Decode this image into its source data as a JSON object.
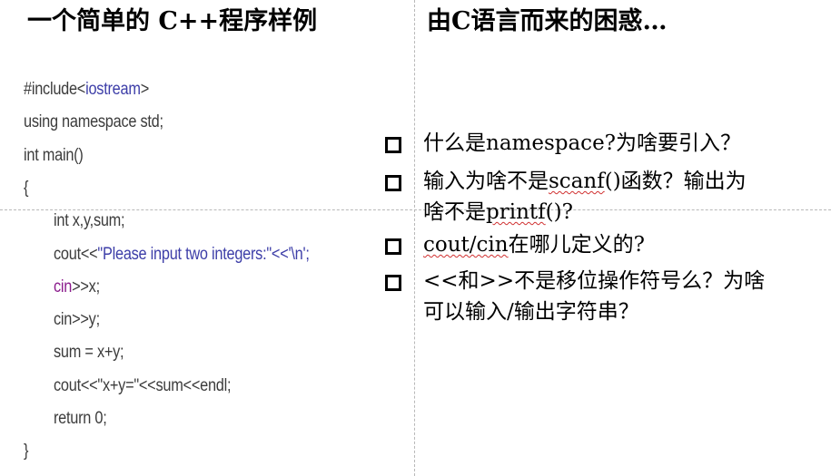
{
  "left_title": "一个简单的 C++程序样例",
  "right_title": "由C语言而来的困惑…",
  "code_lines": [
    {
      "indent": false,
      "segments": [
        {
          "text": "#include<",
          "color": "black"
        },
        {
          "text": "iostream",
          "color": "blue"
        },
        {
          "text": ">",
          "color": "black"
        }
      ]
    },
    {
      "indent": false,
      "segments": [
        {
          "text": "using namespace std;",
          "color": "black"
        }
      ]
    },
    {
      "indent": false,
      "segments": [
        {
          "text": "int main()",
          "color": "black"
        }
      ]
    },
    {
      "indent": false,
      "segments": [
        {
          "text": "{",
          "color": "black"
        }
      ]
    },
    {
      "indent": true,
      "segments": [
        {
          "text": "int x,y,sum;",
          "color": "black"
        }
      ]
    },
    {
      "indent": true,
      "segments": [
        {
          "text": "cout<<",
          "color": "black"
        },
        {
          "text": "\"Please input two integers:\"<<'\\n';",
          "color": "blue"
        }
      ]
    },
    {
      "indent": true,
      "segments": [
        {
          "text": "cin",
          "color": "purple"
        },
        {
          "text": ">>x;",
          "color": "black"
        }
      ]
    },
    {
      "indent": true,
      "segments": [
        {
          "text": "cin>>y;",
          "color": "black"
        }
      ]
    },
    {
      "indent": true,
      "segments": [
        {
          "text": "sum = x+y;",
          "color": "black"
        }
      ]
    },
    {
      "indent": true,
      "segments": [
        {
          "text": "cout<<\"x+y=\"<<sum<<endl;",
          "color": "black"
        }
      ]
    },
    {
      "indent": true,
      "segments": [
        {
          "text": "return 0;",
          "color": "black"
        }
      ]
    },
    {
      "indent": false,
      "segments": [
        {
          "text": "}",
          "color": "black"
        }
      ]
    }
  ],
  "bullets": [
    {
      "lines": [
        [
          {
            "text": "什么是namespace?为啥要引入？",
            "squiggle": false
          }
        ]
      ]
    },
    {
      "lines": [
        [
          {
            "text": "输入为啥不是",
            "squiggle": false
          },
          {
            "text": "scanf",
            "squiggle": true
          },
          {
            "text": "()函数？输出为",
            "squiggle": false
          }
        ],
        [
          {
            "text": "啥不是",
            "squiggle": false
          },
          {
            "text": "printf",
            "squiggle": true
          },
          {
            "text": "()?",
            "squiggle": false
          }
        ]
      ]
    },
    {
      "lines": [
        [
          {
            "text": "cout/cin",
            "squiggle": true
          },
          {
            "text": "在哪儿定义的?",
            "squiggle": false
          }
        ]
      ]
    },
    {
      "lines": [
        [
          {
            "text": "<<和>>不是移位操作符号么？为啥",
            "squiggle": false
          }
        ],
        [
          {
            "text": "可以输入/输出字符串？",
            "squiggle": false
          }
        ]
      ]
    }
  ]
}
